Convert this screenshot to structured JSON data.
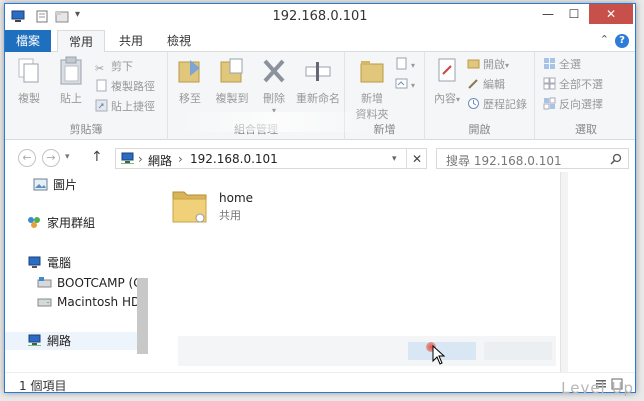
{
  "window": {
    "title": "192.168.0.101",
    "close_label": "✕",
    "max_label": "☐",
    "min_label": "—"
  },
  "tabs": [
    {
      "label": "檔案"
    },
    {
      "label": "常用"
    },
    {
      "label": "共用"
    },
    {
      "label": "檢視"
    }
  ],
  "ribbon": {
    "clipboard": {
      "label": "剪貼簿",
      "copy": "複製",
      "paste": "貼上",
      "cut": "剪下",
      "copy_path": "複製路徑",
      "paste_shortcut": "貼上捷徑"
    },
    "organize": {
      "label": "組合管理",
      "move_to": "移至",
      "copy_to": "複製到",
      "delete": "刪除",
      "rename": "重新命名"
    },
    "new": {
      "label": "新增",
      "new_folder_line1": "新增",
      "new_folder_line2": "資料夾"
    },
    "open": {
      "label": "開啟",
      "properties": "內容",
      "open": "開啟",
      "edit": "編輯",
      "history": "歷程記錄"
    },
    "select": {
      "label": "選取",
      "select_all": "全選",
      "select_none": "全部不選",
      "invert": "反向選擇"
    }
  },
  "address": {
    "crumb_network": "網路",
    "crumb_host": "192.168.0.101",
    "search_placeholder": "搜尋 192.168.0.101"
  },
  "nav_pane": {
    "items": [
      {
        "label": "圖片"
      },
      {
        "label": "家用群組"
      },
      {
        "label": "電腦"
      },
      {
        "label": "BOOTCAMP (C"
      },
      {
        "label": "Macintosh HD"
      },
      {
        "label": "網路"
      }
    ]
  },
  "content": {
    "items": [
      {
        "name": "home",
        "sub": "共用"
      }
    ]
  },
  "status": {
    "item_count": "1 個項目"
  },
  "watermark": "Level Up",
  "colors": {
    "accent": "#1e6fbe",
    "close": "#c7504b"
  }
}
